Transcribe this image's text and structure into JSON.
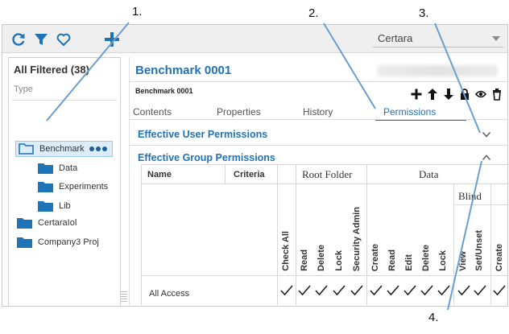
{
  "toolbar": {
    "icons": [
      "refresh-icon",
      "filter-icon",
      "heart-icon",
      "add-icon"
    ],
    "organization": "Certara"
  },
  "left_panel": {
    "title": "All Filtered (38)",
    "type_label": "Type",
    "tree": [
      {
        "label": "Benchmark",
        "selected": true,
        "indent": 0
      },
      {
        "label": "Data",
        "selected": false,
        "indent": 1
      },
      {
        "label": "Experiments",
        "selected": false,
        "indent": 1
      },
      {
        "label": "Lib",
        "selected": false,
        "indent": 1
      },
      {
        "label": "CertaraIol",
        "selected": false,
        "indent": 0
      },
      {
        "label": "Company3 Proj",
        "selected": false,
        "indent": 0
      }
    ]
  },
  "right_panel": {
    "title": "Benchmark 0001",
    "subtitle": "Benchmark 0001",
    "actions": [
      "add-icon",
      "move-up-icon",
      "move-down-icon",
      "lock-icon",
      "eye-icon",
      "trash-icon"
    ],
    "tabs": [
      "Contents",
      "Properties",
      "History",
      "Permissions"
    ],
    "active_tab": "Permissions",
    "sections": {
      "user": "Effective User Permissions",
      "group": "Effective Group Permissions"
    }
  },
  "grid": {
    "headers": {
      "name": "Name",
      "criteria": "Criteria"
    },
    "groups": {
      "root_folder": "Root Folder",
      "data": "Data",
      "blind": "Blind"
    },
    "columns": [
      "Check All",
      "Read",
      "Delete",
      "Lock",
      "Security Admin",
      "Create",
      "Read",
      "Edit",
      "Delete",
      "Lock",
      "View",
      "Set/Unset",
      "Create"
    ],
    "rows": [
      {
        "name": "All Access",
        "checks": [
          true,
          true,
          true,
          true,
          true,
          true,
          true,
          true,
          true,
          true,
          true,
          true,
          true
        ]
      }
    ]
  },
  "callouts": [
    "1.",
    "2.",
    "3.",
    "4."
  ],
  "colors": {
    "accent": "#1f73b7",
    "folder": "#1f73b7"
  }
}
